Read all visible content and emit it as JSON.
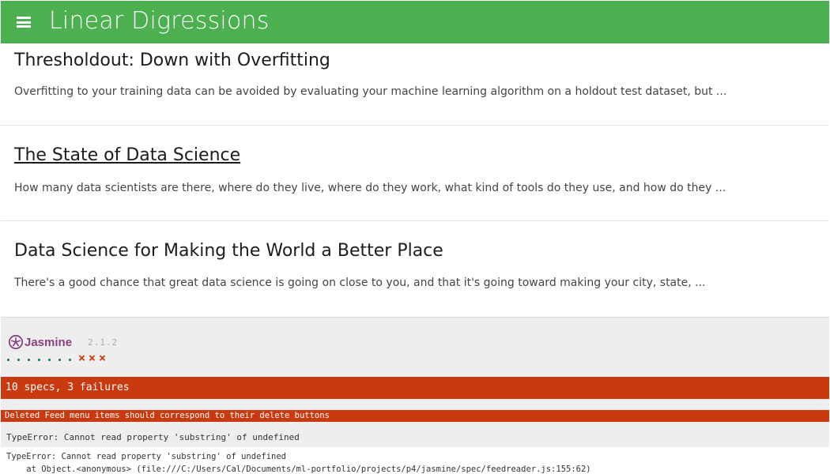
{
  "header": {
    "title": "Linear Digressions",
    "bg_color": "#4caf50",
    "menu_icon": "hamburger-menu-icon"
  },
  "entries": [
    {
      "title": "Thresholdout: Down with Overfitting",
      "snippet": "Overfitting to your training data can be avoided by evaluating your machine learning algorithm on a holdout test dataset, but ..."
    },
    {
      "title": "The State of Data Science",
      "snippet": "How many data scientists are there, where do they live, where do they work, what kind of tools do they use, and how do they ..."
    },
    {
      "title": "Data Science for Making the World a Better Place",
      "snippet": "There's a good chance that great data science is going on close to you, and that it's going toward making your city, state, ..."
    }
  ],
  "jasmine": {
    "logo_text": "Jasmine",
    "version": "2.1.2",
    "passed_count": 7,
    "failed_count": 3,
    "summary": "10 specs, 3 failures",
    "fail_color": "#ca3a11",
    "pass_color": "#007069",
    "failure": {
      "title": "Deleted Feed menu items should correspond to their delete buttons",
      "message": "TypeError: Cannot read property 'substring' of undefined",
      "stack_line1": "TypeError: Cannot read property 'substring' of undefined",
      "stack_line2": "    at Object.<anonymous> (file:///C:/Users/Cal/Documents/ml-portfolio/projects/p4/jasmine/spec/feedreader.js:155:62)"
    }
  }
}
